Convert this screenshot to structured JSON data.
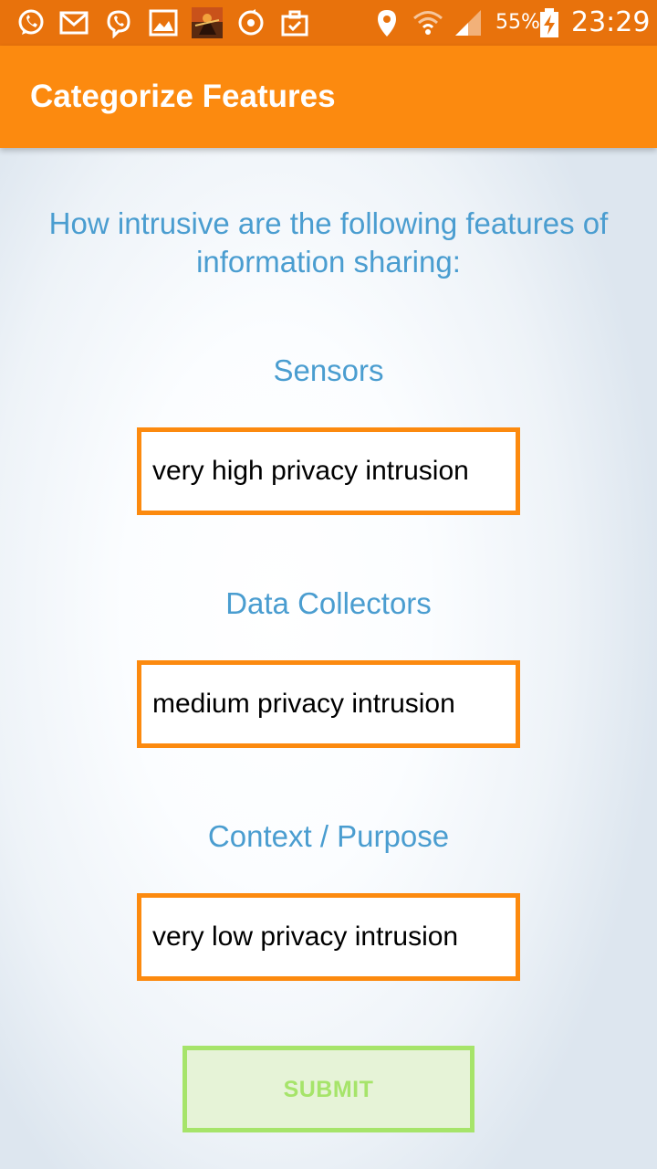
{
  "status_bar": {
    "icons": [
      "whatsapp-icon",
      "gmail-icon",
      "viber-icon",
      "gallery-icon",
      "game-icon",
      "sync-icon",
      "briefcase-icon",
      "location-icon",
      "wifi-icon",
      "signal-icon",
      "battery-charging-icon"
    ],
    "battery_percent": "55%",
    "time": "23:29"
  },
  "app_bar": {
    "title": "Categorize Features"
  },
  "main": {
    "question": "How intrusive are the following features of information sharing:",
    "features": [
      {
        "label": "Sensors",
        "value": "very high privacy intrusion"
      },
      {
        "label": "Data Collectors",
        "value": "medium privacy intrusion"
      },
      {
        "label": "Context / Purpose",
        "value": "very low privacy intrusion"
      }
    ],
    "submit_label": "SUBMIT"
  },
  "colors": {
    "status_bar": "#e8720c",
    "app_bar": "#fc8a0f",
    "accent_text": "#4a9dd0",
    "select_border": "#fc8a0f",
    "submit_border": "#a6e46a",
    "submit_bg": "#e6f3d7"
  }
}
